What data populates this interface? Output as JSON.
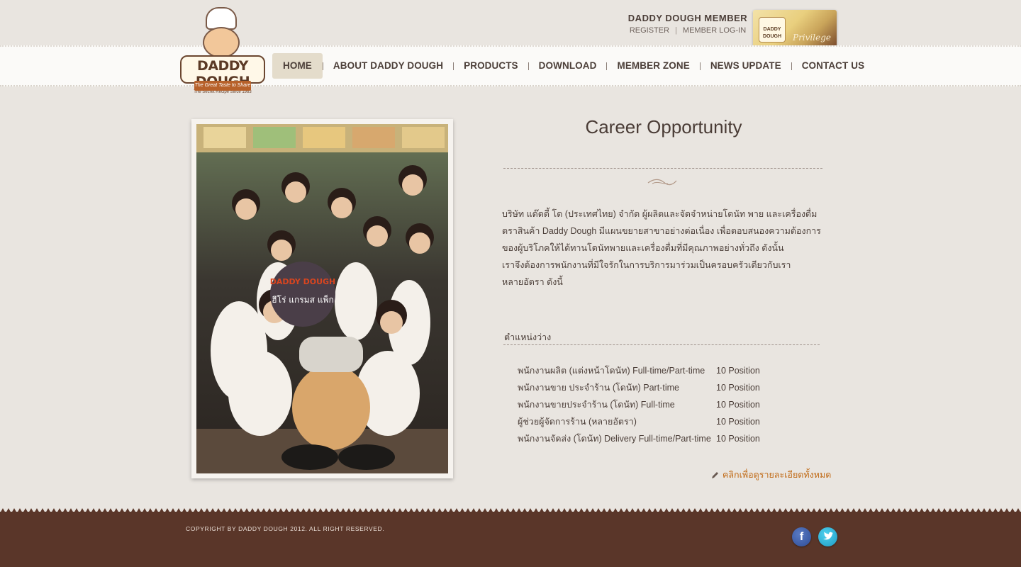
{
  "member": {
    "title": "DADDY DOUGH MEMBER",
    "register": "REGISTER",
    "separator": "|",
    "login": "MEMBER LOG-IN",
    "privilege_text": "Privilege",
    "privilege_logo": "DADDY DOUGH"
  },
  "logo": {
    "brand": "DADDY DOUGH",
    "tagline": "The Secret Recipe Since 1983",
    "ribbon": "The Great Taste to Share"
  },
  "nav": {
    "home": "HOME",
    "about": "ABOUT DADDY DOUGH",
    "products": "PRODUCTS",
    "download": "DOWNLOAD",
    "member_zone": "MEMBER ZONE",
    "news": "NEWS UPDATE",
    "contact": "CONTACT US"
  },
  "content": {
    "title": "Career Opportunity",
    "intro_lines": [
      "บริษัท แด๊ดดี้ โด (ประเทศไทย) จำกัด ผู้ผลิตและจัดจำหน่ายโดนัท พาย และเครื่องดื่ม",
      "ตราสินค้า Daddy Dough มีแผนขยายสาขาอย่างต่อเนื่อง เพื่อตอบสนองความต้องการ",
      "ของผู้บริโภคให้ได้ทานโดนัทพายและเครื่องดื่มที่มีคุณภาพอย่างทั่วถึง ดังนั้น",
      "เราจึงต้องการพนักงานที่มีใจรักในการบริการมาร่วมเป็นครอบครัวเดียวกับเรา",
      "หลายอัตรา ดังนี้"
    ],
    "positions_label": "ตำแหน่งว่าง",
    "jobs": [
      {
        "name": "พนักงานผลิต (แต่งหน้าโดนัท) Full-time/Part-time",
        "count": "10 Position"
      },
      {
        "name": "พนักงานขาย ประจำร้าน (โดนัท) Part-time",
        "count": "10 Position"
      },
      {
        "name": "พนักงานขายประจำร้าน (โดนัท) Full-time",
        "count": "10 Position"
      },
      {
        "name": "ผู้ช่วยผู้จัดการร้าน (หลายอัตรา)",
        "count": "10 Position"
      },
      {
        "name": "พนักงานจัดส่ง (โดนัท) Delivery Full-time/Part-time",
        "count": "10 Position"
      }
    ],
    "more_link": "คลิกเพื่อดูรายละเอียดทั้งหมด",
    "photo_sign_brand": "DADDY DOUGH",
    "photo_sign_text": "ฮีโร่ แกรมส แพ็ก"
  },
  "footer": {
    "copyright": "COPYRIGHT BY DADDY DOUGH 2012. ALL RIGHT RESERVED.",
    "facebook_glyph": "f"
  },
  "colors": {
    "background": "#e9e5e0",
    "footer": "#5a3629",
    "accent_link": "#c06a16",
    "nav_active": "#e4dccb"
  }
}
